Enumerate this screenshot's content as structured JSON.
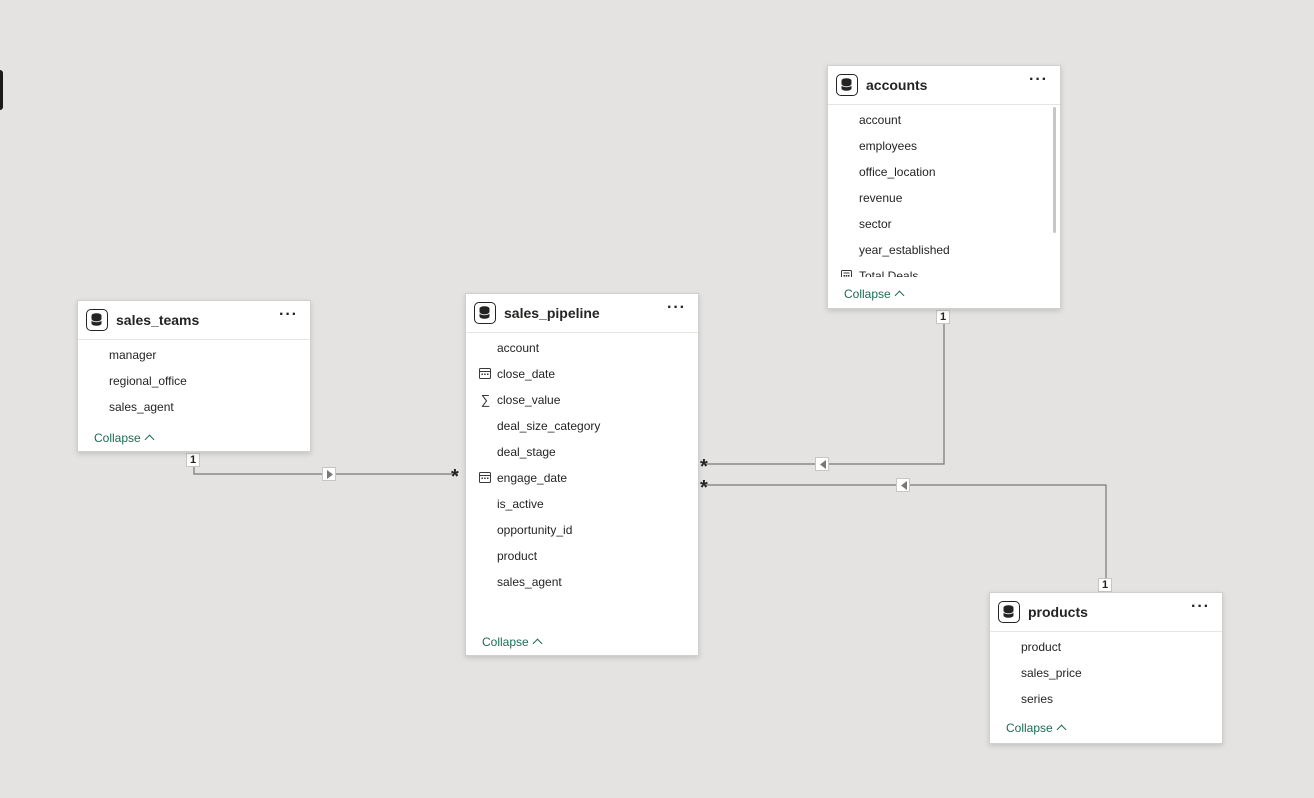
{
  "tables": [
    {
      "id": "sales_teams",
      "title": "sales_teams",
      "fields": [
        {
          "name": "manager",
          "icon": "none"
        },
        {
          "name": "regional_office",
          "icon": "none"
        },
        {
          "name": "sales_agent",
          "icon": "none"
        }
      ],
      "collapse_label": "Collapse"
    },
    {
      "id": "sales_pipeline",
      "title": "sales_pipeline",
      "fields": [
        {
          "name": "account",
          "icon": "none"
        },
        {
          "name": "close_date",
          "icon": "calendar-icon"
        },
        {
          "name": "close_value",
          "icon": "sigma-icon"
        },
        {
          "name": "deal_size_category",
          "icon": "none"
        },
        {
          "name": "deal_stage",
          "icon": "none"
        },
        {
          "name": "engage_date",
          "icon": "calendar-icon"
        },
        {
          "name": "is_active",
          "icon": "none"
        },
        {
          "name": "opportunity_id",
          "icon": "none"
        },
        {
          "name": "product",
          "icon": "none"
        },
        {
          "name": "sales_agent",
          "icon": "none"
        }
      ],
      "collapse_label": "Collapse"
    },
    {
      "id": "accounts",
      "title": "accounts",
      "fields": [
        {
          "name": "account",
          "icon": "none"
        },
        {
          "name": "employees",
          "icon": "none"
        },
        {
          "name": "office_location",
          "icon": "none"
        },
        {
          "name": "revenue",
          "icon": "none"
        },
        {
          "name": "sector",
          "icon": "none"
        },
        {
          "name": "year_established",
          "icon": "none"
        },
        {
          "name": "Total Deals",
          "icon": "measure-icon"
        }
      ],
      "collapse_label": "Collapse"
    },
    {
      "id": "products",
      "title": "products",
      "fields": [
        {
          "name": "product",
          "icon": "none"
        },
        {
          "name": "sales_price",
          "icon": "none"
        },
        {
          "name": "series",
          "icon": "none"
        }
      ],
      "collapse_label": "Collapse"
    }
  ],
  "relationships": [
    {
      "from": "sales_teams",
      "to": "sales_pipeline",
      "from_cardinality": "1",
      "to_cardinality": "*"
    },
    {
      "from": "accounts",
      "to": "sales_pipeline",
      "from_cardinality": "1",
      "to_cardinality": "*"
    },
    {
      "from": "products",
      "to": "sales_pipeline",
      "from_cardinality": "1",
      "to_cardinality": "*"
    }
  ],
  "colors": {
    "canvas": "#e4e3e1",
    "card": "#ffffff",
    "link": "#1e6b57",
    "line": "#7a7876"
  }
}
